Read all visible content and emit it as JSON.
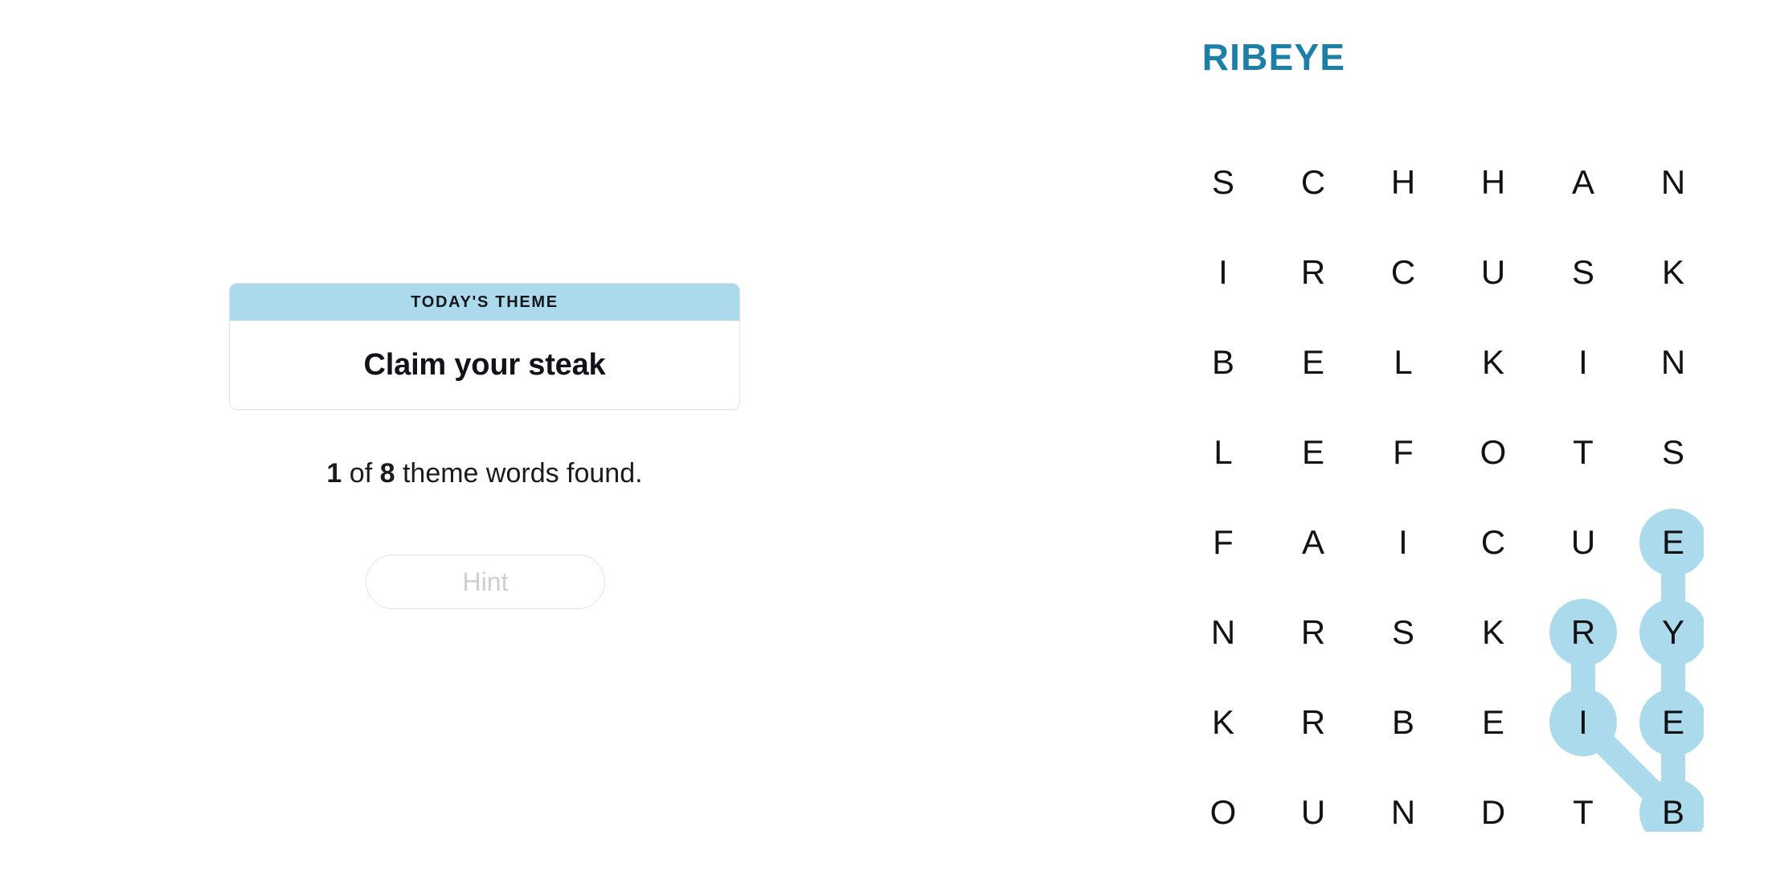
{
  "theme_card": {
    "header_label": "TODAY'S THEME",
    "theme_title": "Claim your steak"
  },
  "progress": {
    "found": "1",
    "mid_text": " of ",
    "total": "8",
    "suffix_text": " theme words found."
  },
  "hint": {
    "label": "Hint",
    "enabled": false
  },
  "puzzle": {
    "title": "RIBEYE",
    "rows": 8,
    "cols": 6,
    "grid": [
      [
        "S",
        "C",
        "H",
        "H",
        "A",
        "N"
      ],
      [
        "I",
        "R",
        "C",
        "U",
        "S",
        "K"
      ],
      [
        "B",
        "E",
        "L",
        "K",
        "I",
        "N"
      ],
      [
        "L",
        "E",
        "F",
        "O",
        "T",
        "S"
      ],
      [
        "F",
        "A",
        "I",
        "C",
        "U",
        "E"
      ],
      [
        "N",
        "R",
        "S",
        "K",
        "R",
        "Y"
      ],
      [
        "K",
        "R",
        "B",
        "E",
        "I",
        "E"
      ],
      [
        "O",
        "U",
        "N",
        "D",
        "T",
        "B"
      ]
    ],
    "found_word": {
      "word": "RIBEYE",
      "path": [
        {
          "row": 5,
          "col": 4,
          "letter": "R"
        },
        {
          "row": 6,
          "col": 4,
          "letter": "I"
        },
        {
          "row": 7,
          "col": 5,
          "letter": "B"
        },
        {
          "row": 6,
          "col": 5,
          "letter": "E"
        },
        {
          "row": 5,
          "col": 5,
          "letter": "Y"
        },
        {
          "row": 4,
          "col": 5,
          "letter": "E"
        }
      ]
    }
  },
  "colors": {
    "title_teal": "#1b7fa8",
    "highlight_blue": "#abdaec",
    "theme_header_blue": "#abdaec",
    "letter_black": "#121212",
    "hint_disabled_gray": "#cfcfcf"
  }
}
